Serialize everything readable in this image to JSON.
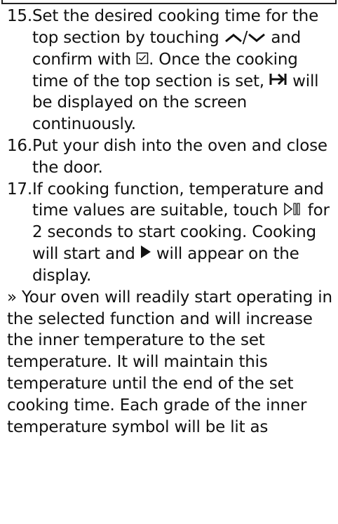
{
  "steps": [
    {
      "number": "15",
      "segments": {
        "a": "Set the desired cooking time for the top section by touching",
        "b": "/",
        "c": "and confirm with",
        "d": ". Once the cooking time of the top section is set,",
        "e": "will be displayed on the screen continuously."
      }
    },
    {
      "number": "16",
      "segments": {
        "a": "Put your dish into the oven and close the door."
      }
    },
    {
      "number": "17",
      "segments": {
        "a": "If cooking function, temperature and time values are suitable, touch",
        "b": "for 2 seconds to start cooking. Cooking will start and",
        "c": "will appear on the display."
      }
    }
  ],
  "result": {
    "text": "» Your oven will readily start operating in the selected function and will increase the inner temperature to the set temperature. It will maintain this temperature until the end of the set cooking time. Each grade of the inner temperature symbol will be lit as"
  },
  "icons": {
    "up_arrow": "chevron-up-icon",
    "down_arrow": "chevron-down-icon",
    "confirm": "checkbox-confirm-icon",
    "top_section": "arrow-to-bar-icon",
    "start_pause": "start-pause-icon",
    "play": "play-icon"
  }
}
